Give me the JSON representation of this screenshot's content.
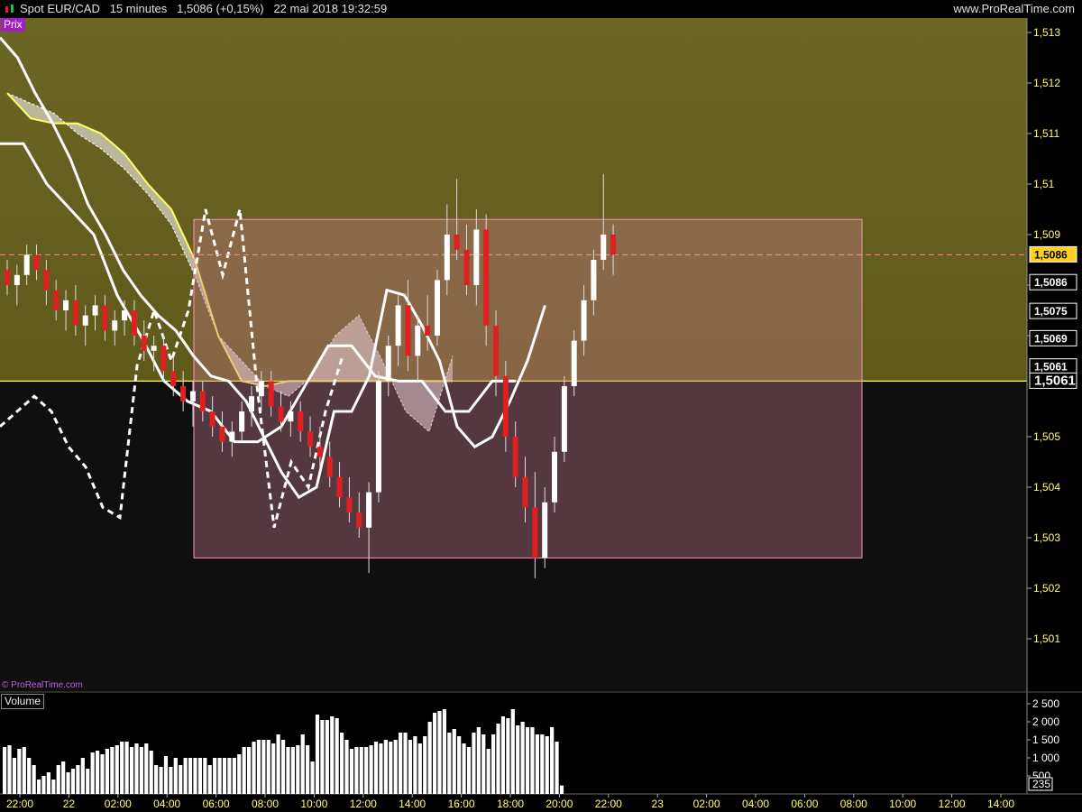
{
  "header": {
    "title": "Spot EUR/CAD   15 minutes   1,5086 (+0,15%)   22 mai 2018 19:32:59",
    "site": "www.ProRealTime.com"
  },
  "price_panel": {
    "label": "Prix",
    "copyright": "© ProRealTime.com",
    "badges": {
      "last": "1,5086",
      "a": "1,5086",
      "b": "1,5075",
      "c": "1,5069",
      "d": "1,5061",
      "e": "1,5061"
    }
  },
  "volume_panel": {
    "label": "Volume",
    "last_badge": "235"
  },
  "colors": {
    "upper_zone": "#5f5a1a",
    "lower_zone": "#0f0f0f",
    "box_fill": "#c87a8e",
    "box_stroke": "#ff8fc0",
    "axis_text": "#ffff66",
    "candle_up": "#ffffff",
    "candle_down": "#e02020",
    "kijun_line": "#ffff66"
  },
  "chart_data": [
    {
      "type": "candlestick",
      "title": "Spot EUR/CAD",
      "timeframe": "15 minutes",
      "ylim": [
        1.5003,
        1.5133
      ],
      "y_ticks": [
        "1,501",
        "1,502",
        "1,503",
        "1,504",
        "1,505",
        "1,507",
        "1,508",
        "1,509",
        "1,51",
        "1,511",
        "1,512",
        "1,513"
      ],
      "x_ticks": [
        "22:00",
        "22",
        "02:00",
        "04:00",
        "06:00",
        "08:00",
        "10:00",
        "12:00",
        "14:00",
        "16:00",
        "18:00",
        "20:00",
        "22:00",
        "23",
        "02:00",
        "04:00",
        "06:00",
        "08:00",
        "10:00",
        "12:00",
        "14:00"
      ],
      "last_price": 1.5086,
      "zone_level": 1.5061,
      "box": {
        "y_high": 1.5093,
        "y_low": 1.5026
      },
      "candles": [
        [
          1.5083,
          1.5085,
          1.5078,
          1.508
        ],
        [
          1.508,
          1.5084,
          1.5076,
          1.5082
        ],
        [
          1.5082,
          1.5088,
          1.508,
          1.5086
        ],
        [
          1.5086,
          1.5088,
          1.5081,
          1.5083
        ],
        [
          1.5083,
          1.5085,
          1.5076,
          1.5079
        ],
        [
          1.5079,
          1.5081,
          1.5073,
          1.5075
        ],
        [
          1.5075,
          1.5079,
          1.5071,
          1.5077
        ],
        [
          1.5077,
          1.508,
          1.507,
          1.5072
        ],
        [
          1.5072,
          1.5076,
          1.5068,
          1.5074
        ],
        [
          1.5074,
          1.5078,
          1.5071,
          1.5076
        ],
        [
          1.5076,
          1.5078,
          1.5069,
          1.5071
        ],
        [
          1.5071,
          1.5075,
          1.5068,
          1.5073
        ],
        [
          1.5073,
          1.5077,
          1.507,
          1.5075
        ],
        [
          1.5075,
          1.5077,
          1.5068,
          1.507
        ],
        [
          1.507,
          1.5073,
          1.5065,
          1.5067
        ],
        [
          1.5067,
          1.507,
          1.5063,
          1.5068
        ],
        [
          1.5068,
          1.507,
          1.5061,
          1.5063
        ],
        [
          1.5063,
          1.5066,
          1.5058,
          1.506
        ],
        [
          1.506,
          1.5063,
          1.5055,
          1.5057
        ],
        [
          1.5057,
          1.5061,
          1.5052,
          1.5059
        ],
        [
          1.5059,
          1.5061,
          1.5053,
          1.5055
        ],
        [
          1.5055,
          1.5058,
          1.505,
          1.5052
        ],
        [
          1.5052,
          1.5055,
          1.5047,
          1.5049
        ],
        [
          1.5049,
          1.5053,
          1.5046,
          1.5051
        ],
        [
          1.5051,
          1.5057,
          1.5049,
          1.5055
        ],
        [
          1.5055,
          1.506,
          1.5052,
          1.5058
        ],
        [
          1.5058,
          1.5063,
          1.5055,
          1.5061
        ],
        [
          1.5061,
          1.5063,
          1.5054,
          1.5056
        ],
        [
          1.5056,
          1.5059,
          1.5051,
          1.5053
        ],
        [
          1.5053,
          1.5057,
          1.505,
          1.5055
        ],
        [
          1.5055,
          1.5057,
          1.5049,
          1.5051
        ],
        [
          1.5051,
          1.5054,
          1.5046,
          1.5048
        ],
        [
          1.5048,
          1.5052,
          1.5044,
          1.5046
        ],
        [
          1.5046,
          1.5049,
          1.504,
          1.5042
        ],
        [
          1.5042,
          1.5045,
          1.5036,
          1.5038
        ],
        [
          1.5038,
          1.5042,
          1.5033,
          1.5035
        ],
        [
          1.5035,
          1.5039,
          1.503,
          1.5032
        ],
        [
          1.5032,
          1.5041,
          1.5023,
          1.5039
        ],
        [
          1.5039,
          1.5063,
          1.5037,
          1.5061
        ],
        [
          1.5061,
          1.507,
          1.5058,
          1.5068
        ],
        [
          1.5068,
          1.5078,
          1.5064,
          1.5076
        ],
        [
          1.5076,
          1.5081,
          1.5063,
          1.5066
        ],
        [
          1.5066,
          1.5074,
          1.5061,
          1.5072
        ],
        [
          1.5072,
          1.5078,
          1.5067,
          1.507
        ],
        [
          1.507,
          1.5083,
          1.5068,
          1.5081
        ],
        [
          1.5081,
          1.5096,
          1.5078,
          1.509
        ],
        [
          1.509,
          1.5101,
          1.5085,
          1.5087
        ],
        [
          1.5087,
          1.5092,
          1.5078,
          1.508
        ],
        [
          1.508,
          1.5095,
          1.5076,
          1.5091
        ],
        [
          1.5091,
          1.5094,
          1.5068,
          1.5072
        ],
        [
          1.5072,
          1.5075,
          1.5058,
          1.5062
        ],
        [
          1.5062,
          1.5065,
          1.5047,
          1.505
        ],
        [
          1.505,
          1.5053,
          1.504,
          1.5042
        ],
        [
          1.5042,
          1.5046,
          1.5033,
          1.5036
        ],
        [
          1.5036,
          1.5043,
          1.5022,
          1.5026
        ],
        [
          1.5026,
          1.504,
          1.5024,
          1.5037
        ],
        [
          1.5037,
          1.505,
          1.5035,
          1.5047
        ],
        [
          1.5047,
          1.5062,
          1.5045,
          1.506
        ],
        [
          1.506,
          1.5071,
          1.5058,
          1.5069
        ],
        [
          1.5069,
          1.508,
          1.5066,
          1.5077
        ],
        [
          1.5077,
          1.5087,
          1.5074,
          1.5085
        ],
        [
          1.5085,
          1.5102,
          1.5083,
          1.509
        ],
        [
          1.509,
          1.5092,
          1.5082,
          1.5086
        ]
      ],
      "overlays": {
        "tenkan_sen": [
          1.5129,
          1.5125,
          1.5118,
          1.5112,
          1.5105,
          1.5096,
          1.509,
          1.5083,
          1.5078,
          1.5074,
          1.5071,
          1.5066,
          1.5062,
          1.5061,
          1.5057,
          1.505,
          1.5043,
          1.5038,
          1.504,
          1.5055,
          1.5055,
          1.5062,
          1.5079,
          1.5078,
          1.5072,
          1.5065,
          1.5052,
          1.5048,
          1.505,
          1.5057,
          1.5065,
          1.5076
        ],
        "kijun_sen": [
          1.5108,
          1.5108,
          1.51,
          1.5095,
          1.509,
          1.5078,
          1.507,
          1.5061,
          1.5057,
          1.5055,
          1.5049,
          1.5049,
          1.5052,
          1.506,
          1.5068,
          1.5068,
          1.5062,
          1.5061,
          1.5061,
          1.5055,
          1.5055,
          1.5061,
          1.5061
        ],
        "chikou_span": [
          1.5052,
          1.5055,
          1.5058,
          1.5055,
          1.5048,
          1.5044,
          1.5036,
          1.5034,
          1.5064,
          1.5075,
          1.5065,
          1.5075,
          1.5095,
          1.5082,
          1.5095,
          1.506,
          1.5032,
          1.5045,
          1.504,
          1.5055,
          1.5066
        ],
        "senkou_span_a": [
          1.5118,
          1.5116,
          1.5114,
          1.511,
          1.5107,
          1.5103,
          1.5098,
          1.5092,
          1.5082,
          1.507,
          1.5065,
          1.506,
          1.5058,
          1.5062,
          1.507,
          1.5074,
          1.5065,
          1.5055,
          1.5051,
          1.5066
        ],
        "senkou_span_b": [
          1.5118,
          1.5113,
          1.5112,
          1.5112,
          1.511,
          1.5106,
          1.51,
          1.5095,
          1.5085,
          1.507,
          1.5061,
          1.506,
          1.5061,
          1.5061,
          1.5061,
          1.5061,
          1.5061
        ]
      }
    },
    {
      "type": "bar",
      "title": "Volume",
      "ylim": [
        0,
        2600
      ],
      "y_ticks": [
        "500",
        "1 000",
        "1 500",
        "2 000",
        "2 500"
      ],
      "values": [
        1300,
        1350,
        1000,
        1250,
        1300,
        1000,
        800,
        400,
        500,
        600,
        400,
        800,
        900,
        600,
        700,
        800,
        1000,
        700,
        1150,
        1200,
        1100,
        1250,
        1300,
        1350,
        1450,
        1450,
        1300,
        1400,
        1300,
        1400,
        1200,
        800,
        750,
        1050,
        750,
        1000,
        800,
        1000,
        1000,
        1000,
        1000,
        1000,
        800,
        1000,
        1000,
        1000,
        1000,
        1000,
        1100,
        1300,
        1300,
        1450,
        1500,
        1500,
        1500,
        1400,
        1650,
        1500,
        1300,
        1300,
        1350,
        1650,
        1350,
        900,
        2200,
        2050,
        2050,
        2150,
        2100,
        1700,
        1500,
        1250,
        1300,
        1300,
        1300,
        1350,
        1450,
        1400,
        1500,
        1450,
        1500,
        1700,
        1700,
        1500,
        1600,
        1400,
        1600,
        2000,
        2250,
        2300,
        2350,
        1700,
        1800,
        1600,
        1400,
        1300,
        1700,
        1850,
        1650,
        1250,
        1650,
        1950,
        2150,
        2100,
        2350,
        1900,
        2000,
        1850,
        1850,
        1650,
        1650,
        1600,
        1850,
        1450,
        235
      ]
    }
  ]
}
